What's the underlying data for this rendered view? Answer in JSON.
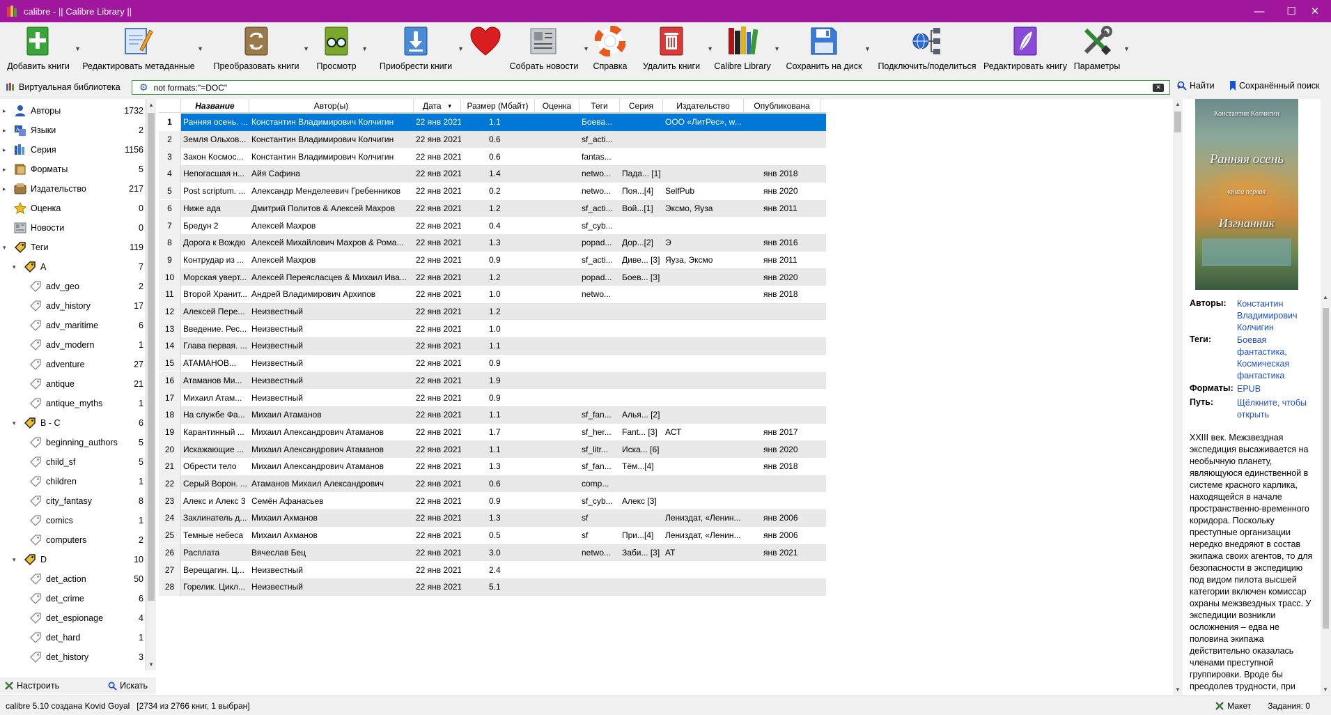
{
  "window": {
    "title": "calibre - || Calibre Library ||",
    "controls": {
      "minimize": "—",
      "maximize": "☐",
      "close": "✕"
    }
  },
  "toolbar": [
    {
      "name": "add-books",
      "label": "Добавить книги",
      "icon": "plus-book-icon",
      "has_menu": true
    },
    {
      "name": "edit-metadata",
      "label": "Редактировать метаданные",
      "icon": "pencil-page-icon",
      "has_menu": true
    },
    {
      "name": "convert-books",
      "label": "Преобразовать книги",
      "icon": "convert-icon",
      "has_menu": true
    },
    {
      "name": "view",
      "label": "Просмотр",
      "icon": "glasses-book-icon",
      "has_menu": true
    },
    {
      "name": "get-books",
      "label": "Приобрести книги",
      "icon": "download-icon",
      "has_menu": true
    },
    {
      "name": "donate",
      "label": "",
      "icon": "heart-icon",
      "has_menu": false
    },
    {
      "name": "fetch-news",
      "label": "Собрать новости",
      "icon": "newspaper-icon",
      "has_menu": true
    },
    {
      "name": "help",
      "label": "Справка",
      "icon": "lifebuoy-icon",
      "has_menu": false
    },
    {
      "name": "remove-books",
      "label": "Удалить книги",
      "icon": "trash-icon",
      "has_menu": true
    },
    {
      "name": "calibre-library",
      "label": "Calibre Library",
      "icon": "library-icon",
      "has_menu": true
    },
    {
      "name": "save-to-disk",
      "label": "Сохранить на диск",
      "icon": "floppy-icon",
      "has_menu": true
    },
    {
      "name": "connect-share",
      "label": "Подключить/поделиться",
      "icon": "network-icon",
      "has_menu": false
    },
    {
      "name": "edit-book",
      "label": "Редактировать книгу",
      "icon": "feather-book-icon",
      "has_menu": false
    },
    {
      "name": "preferences",
      "label": "Параметры",
      "icon": "tools-icon",
      "has_menu": true
    }
  ],
  "search": {
    "virtual_library": "Виртуальная библиотека",
    "value": "not formats:\"=DOC\"",
    "find_label": "Найти",
    "saved_label": "Сохранённый поиск"
  },
  "tag_browser": {
    "items": [
      {
        "label": "Авторы",
        "count": "1732",
        "icon": "person-icon",
        "level": 0,
        "expander": "▸"
      },
      {
        "label": "Языки",
        "count": "2",
        "icon": "language-icon",
        "level": 0,
        "expander": "▸"
      },
      {
        "label": "Серия",
        "count": "1156",
        "icon": "series-icon",
        "level": 0,
        "expander": "▸"
      },
      {
        "label": "Форматы",
        "count": "5",
        "icon": "formats-icon",
        "level": 0,
        "expander": "▸"
      },
      {
        "label": "Издательство",
        "count": "217",
        "icon": "publisher-icon",
        "level": 0,
        "expander": "▸"
      },
      {
        "label": "Оценка",
        "count": "0",
        "icon": "star-icon",
        "level": 0,
        "expander": ""
      },
      {
        "label": "Новости",
        "count": "0",
        "icon": "news-icon",
        "level": 0,
        "expander": ""
      },
      {
        "label": "Теги",
        "count": "119",
        "icon": "tag-icon",
        "level": 0,
        "expander": "▾"
      },
      {
        "label": "A",
        "count": "7",
        "icon": "tag-icon",
        "level": 1,
        "expander": "▾"
      },
      {
        "label": "adv_geo",
        "count": "2",
        "icon": "tag-outline-icon",
        "level": 2,
        "expander": ""
      },
      {
        "label": "adv_history",
        "count": "17",
        "icon": "tag-outline-icon",
        "level": 2,
        "expander": ""
      },
      {
        "label": "adv_maritime",
        "count": "6",
        "icon": "tag-outline-icon",
        "level": 2,
        "expander": ""
      },
      {
        "label": "adv_modern",
        "count": "1",
        "icon": "tag-outline-icon",
        "level": 2,
        "expander": ""
      },
      {
        "label": "adventure",
        "count": "27",
        "icon": "tag-outline-icon",
        "level": 2,
        "expander": ""
      },
      {
        "label": "antique",
        "count": "21",
        "icon": "tag-outline-icon",
        "level": 2,
        "expander": ""
      },
      {
        "label": "antique_myths",
        "count": "1",
        "icon": "tag-outline-icon",
        "level": 2,
        "expander": ""
      },
      {
        "label": "B - C",
        "count": "6",
        "icon": "tag-icon",
        "level": 1,
        "expander": "▾"
      },
      {
        "label": "beginning_authors",
        "count": "5",
        "icon": "tag-outline-icon",
        "level": 2,
        "expander": ""
      },
      {
        "label": "child_sf",
        "count": "5",
        "icon": "tag-outline-icon",
        "level": 2,
        "expander": ""
      },
      {
        "label": "children",
        "count": "1",
        "icon": "tag-outline-icon",
        "level": 2,
        "expander": ""
      },
      {
        "label": "city_fantasy",
        "count": "8",
        "icon": "tag-outline-icon",
        "level": 2,
        "expander": ""
      },
      {
        "label": "comics",
        "count": "1",
        "icon": "tag-outline-icon",
        "level": 2,
        "expander": ""
      },
      {
        "label": "computers",
        "count": "2",
        "icon": "tag-outline-icon",
        "level": 2,
        "expander": ""
      },
      {
        "label": "D",
        "count": "10",
        "icon": "tag-icon",
        "level": 1,
        "expander": "▾"
      },
      {
        "label": "det_action",
        "count": "50",
        "icon": "tag-outline-icon",
        "level": 2,
        "expander": ""
      },
      {
        "label": "det_crime",
        "count": "6",
        "icon": "tag-outline-icon",
        "level": 2,
        "expander": ""
      },
      {
        "label": "det_espionage",
        "count": "4",
        "icon": "tag-outline-icon",
        "level": 2,
        "expander": ""
      },
      {
        "label": "det_hard",
        "count": "1",
        "icon": "tag-outline-icon",
        "level": 2,
        "expander": ""
      },
      {
        "label": "det_history",
        "count": "3",
        "icon": "tag-outline-icon",
        "level": 2,
        "expander": ""
      }
    ],
    "configure_label": "Настроить",
    "find_label": "Искать"
  },
  "book_list": {
    "columns": [
      "Название",
      "Автор(ы)",
      "Дата",
      "Размер (Мбайт)",
      "Оценка",
      "Теги",
      "Серия",
      "Издательство",
      "Опубликована"
    ],
    "sorted_column": "Название",
    "sort_indicator": "▾",
    "rows": [
      {
        "n": "1",
        "title": "Ранняя осень. ...",
        "authors": "Константин Владимирович Колчигин",
        "date": "22 янв 2021",
        "size": "1.1",
        "rating": "",
        "tags": "Боева...",
        "series": "",
        "publisher": "ООО «ЛитРес», w...",
        "published": ""
      },
      {
        "n": "2",
        "title": "Земля Ольхов...",
        "authors": "Константин Владимирович Колчигин",
        "date": "22 янв 2021",
        "size": "0.6",
        "rating": "",
        "tags": "sf_acti...",
        "series": "",
        "publisher": "",
        "published": ""
      },
      {
        "n": "3",
        "title": "Закон Космос...",
        "authors": "Константин Владимирович Колчигин",
        "date": "22 янв 2021",
        "size": "0.6",
        "rating": "",
        "tags": "fantas...",
        "series": "",
        "publisher": "",
        "published": ""
      },
      {
        "n": "4",
        "title": "Непогасшая н...",
        "authors": "Айя Сафина",
        "date": "22 янв 2021",
        "size": "1.4",
        "rating": "",
        "tags": "netwo...",
        "series": "Пада... [1]",
        "publisher": "",
        "published": "янв 2018"
      },
      {
        "n": "5",
        "title": "Post scriptum. ...",
        "authors": "Александр Менделеевич Гребенников",
        "date": "22 янв 2021",
        "size": "0.2",
        "rating": "",
        "tags": "netwo...",
        "series": "Поя...[4]",
        "publisher": "SelfPub",
        "published": "янв 2020"
      },
      {
        "n": "6",
        "title": "Ниже ада",
        "authors": "Дмитрий Политов & Алексей Махров",
        "date": "22 янв 2021",
        "size": "1.2",
        "rating": "",
        "tags": "sf_acti...",
        "series": "Вой...[1]",
        "publisher": "Эксмо, Яуза",
        "published": "янв 2011"
      },
      {
        "n": "7",
        "title": "Бредун 2",
        "authors": "Алексей Махров",
        "date": "22 янв 2021",
        "size": "0.4",
        "rating": "",
        "tags": "sf_cyb...",
        "series": "",
        "publisher": "",
        "published": ""
      },
      {
        "n": "8",
        "title": "Дорога к Вождю",
        "authors": "Алексей Михайлович Махров & Рома...",
        "date": "22 янв 2021",
        "size": "1.3",
        "rating": "",
        "tags": "popad...",
        "series": "Дор...[2]",
        "publisher": "Э",
        "published": "янв 2016"
      },
      {
        "n": "9",
        "title": "Контрудар из ...",
        "authors": "Алексей Махров",
        "date": "22 янв 2021",
        "size": "0.9",
        "rating": "",
        "tags": "sf_acti...",
        "series": "Диве... [3]",
        "publisher": "Яуза, Эксмо",
        "published": "янв 2011"
      },
      {
        "n": "10",
        "title": "Морская уверт...",
        "authors": "Алексей Переясласцев & Михаил Ива...",
        "date": "22 янв 2021",
        "size": "1.2",
        "rating": "",
        "tags": "popad...",
        "series": "Боев... [3]",
        "publisher": "",
        "published": "янв 2020"
      },
      {
        "n": "11",
        "title": "Второй Хранит...",
        "authors": "Андрей Владимирович Архипов",
        "date": "22 янв 2021",
        "size": "1.0",
        "rating": "",
        "tags": "netwo...",
        "series": "",
        "publisher": "",
        "published": "янв 2018"
      },
      {
        "n": "12",
        "title": "Алексей Пере...",
        "authors": "Неизвестный",
        "date": "22 янв 2021",
        "size": "1.2",
        "rating": "",
        "tags": "",
        "series": "",
        "publisher": "",
        "published": ""
      },
      {
        "n": "13",
        "title": "Введение. Рес...",
        "authors": "Неизвестный",
        "date": "22 янв 2021",
        "size": "1.0",
        "rating": "",
        "tags": "",
        "series": "",
        "publisher": "",
        "published": ""
      },
      {
        "n": "14",
        "title": "Глава первая. ...",
        "authors": "Неизвестный",
        "date": "22 янв 2021",
        "size": "1.1",
        "rating": "",
        "tags": "",
        "series": "",
        "publisher": "",
        "published": ""
      },
      {
        "n": "15",
        "title": "АТАМАНОВ...",
        "authors": "Неизвестный",
        "date": "22 янв 2021",
        "size": "0.9",
        "rating": "",
        "tags": "",
        "series": "",
        "publisher": "",
        "published": ""
      },
      {
        "n": "16",
        "title": "Атаманов Ми...",
        "authors": "Неизвестный",
        "date": "22 янв 2021",
        "size": "1.9",
        "rating": "",
        "tags": "",
        "series": "",
        "publisher": "",
        "published": ""
      },
      {
        "n": "17",
        "title": "Михаил Атам...",
        "authors": "Неизвестный",
        "date": "22 янв 2021",
        "size": "0.9",
        "rating": "",
        "tags": "",
        "series": "",
        "publisher": "",
        "published": ""
      },
      {
        "n": "18",
        "title": "На службе Фа...",
        "authors": "Михаил Атаманов",
        "date": "22 янв 2021",
        "size": "1.1",
        "rating": "",
        "tags": "sf_fan...",
        "series": "Алья... [2]",
        "publisher": "",
        "published": ""
      },
      {
        "n": "19",
        "title": "Карантинный ...",
        "authors": "Михаил Александрович Атаманов",
        "date": "22 янв 2021",
        "size": "1.7",
        "rating": "",
        "tags": "sf_her...",
        "series": "Fant... [3]",
        "publisher": "АСТ",
        "published": "янв 2017"
      },
      {
        "n": "20",
        "title": "Искажающие ...",
        "authors": "Михаил Александрович Атаманов",
        "date": "22 янв 2021",
        "size": "1.1",
        "rating": "",
        "tags": "sf_litr...",
        "series": "Иска... [6]",
        "publisher": "",
        "published": "янв 2020"
      },
      {
        "n": "21",
        "title": "Обрести тело",
        "authors": "Михаил Александрович Атаманов",
        "date": "22 янв 2021",
        "size": "1.3",
        "rating": "",
        "tags": "sf_fan...",
        "series": "Тём...[4]",
        "publisher": "",
        "published": "янв 2018"
      },
      {
        "n": "22",
        "title": "Серый Ворон. ...",
        "authors": "Атаманов Михаил Александрович",
        "date": "22 янв 2021",
        "size": "0.6",
        "rating": "",
        "tags": "comp...",
        "series": "",
        "publisher": "",
        "published": ""
      },
      {
        "n": "23",
        "title": "Алекс и Алекс 3",
        "authors": "Семён Афанасьев",
        "date": "22 янв 2021",
        "size": "0.9",
        "rating": "",
        "tags": "sf_cyb...",
        "series": "Алекс [3]",
        "publisher": "",
        "published": ""
      },
      {
        "n": "24",
        "title": "Заклинатель д...",
        "authors": "Михаил Ахманов",
        "date": "22 янв 2021",
        "size": "1.3",
        "rating": "",
        "tags": "sf",
        "series": "",
        "publisher": "Лениздат, «Ленин...",
        "published": "янв 2006"
      },
      {
        "n": "25",
        "title": "Темные небеса",
        "authors": "Михаил Ахманов",
        "date": "22 янв 2021",
        "size": "0.5",
        "rating": "",
        "tags": "sf",
        "series": "При...[4]",
        "publisher": "Лениздат, «Ленин...",
        "published": "янв 2006"
      },
      {
        "n": "26",
        "title": "Расплата",
        "authors": "Вячеслав Бец",
        "date": "22 янв 2021",
        "size": "3.0",
        "rating": "",
        "tags": "netwo...",
        "series": "Заби... [3]",
        "publisher": "АТ",
        "published": "янв 2021"
      },
      {
        "n": "27",
        "title": "Верещагин. Ц...",
        "authors": "Неизвестный",
        "date": "22 янв 2021",
        "size": "2.4",
        "rating": "",
        "tags": "",
        "series": "",
        "publisher": "",
        "published": ""
      },
      {
        "n": "28",
        "title": "Горелик. Цикл...",
        "authors": "Неизвестный",
        "date": "22 янв 2021",
        "size": "5.1",
        "rating": "",
        "tags": "",
        "series": "",
        "publisher": "",
        "published": ""
      }
    ]
  },
  "details": {
    "cover_author": "Константин Колчигин",
    "cover_title": "Ранняя осень",
    "cover_sub": "книга первая",
    "cover_sub2": "Изгнанник",
    "authors_label": "Авторы:",
    "authors_value": "Константин Владимирович Колчигин",
    "tags_label": "Теги:",
    "tags_value": "Боевая фантастика, Космическая фантастика",
    "formats_label": "Форматы:",
    "formats_value": "EPUB",
    "path_label": "Путь:",
    "path_value": "Щёлкните, чтобы открыть",
    "description": "XXIII век. Межзвездная экспедиция высаживается на необычную планету, являющуюся единственной в системе красного карлика, находящейся в начале пространственно-временного коридора. Поскольку преступные организации нередко внедряют в состав экипажа своих агентов, то для безопасности в экспедицию под видом пилота высшей категории включен комиссар охраны межзвездных трасс. У экспедиции возникли осложнения – едва не половина экипажа действительно оказалась членами преступной группировки. Вроде бы преодолев трудности, при"
  },
  "status": {
    "left": "calibre 5.10 создана Kovid Goyal",
    "count": "[2734 из 2766 книг, 1 выбран]",
    "layout_label": "Макет",
    "jobs_label": "Задания: 0"
  },
  "colors": {
    "titlebar": "#a0169c",
    "selection": "#0078d7",
    "search_border": "#3c9e3c",
    "link": "#1a4fd8"
  }
}
